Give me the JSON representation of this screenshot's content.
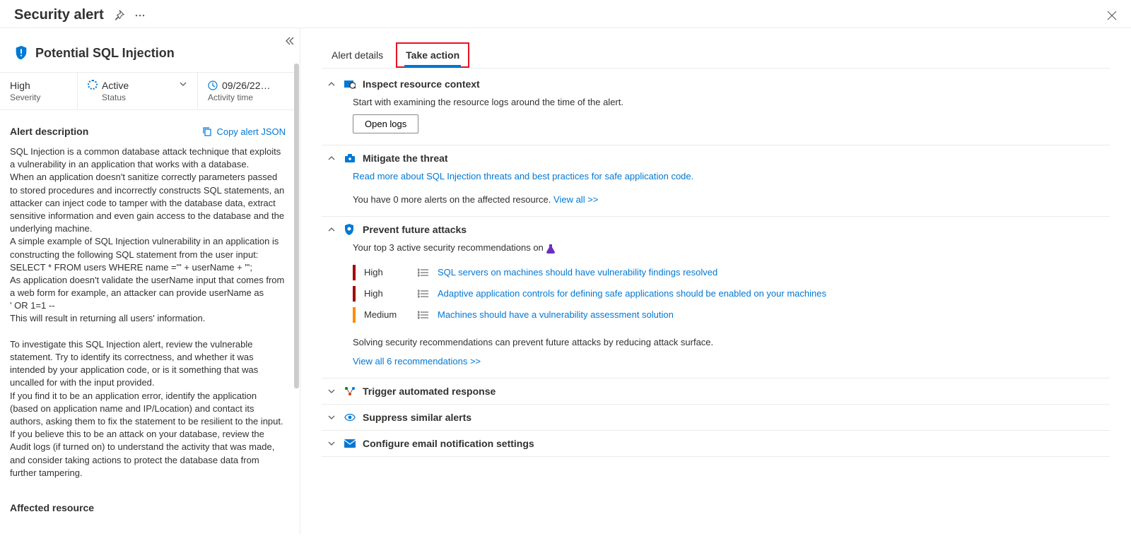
{
  "header": {
    "title": "Security alert"
  },
  "alert": {
    "title": "Potential SQL Injection",
    "severity": {
      "value": "High",
      "label": "Severity"
    },
    "status": {
      "value": "Active",
      "label": "Status"
    },
    "time": {
      "value": "09/26/22…",
      "label": "Activity time"
    }
  },
  "description": {
    "heading": "Alert description",
    "copy_label": "Copy alert JSON",
    "text": "SQL Injection is a common database attack technique that exploits a vulnerability in an application that works with a database.\nWhen an application doesn't sanitize correctly parameters passed to stored procedures and incorrectly constructs SQL statements, an attacker can inject code to tamper with the database data, extract sensitive information and even gain access to the database and the underlying machine.\nA simple example of SQL Injection vulnerability in an application is constructing the following SQL statement from the user input:\nSELECT * FROM users WHERE name ='\" + userName + \"';\nAs application doesn't validate the userName input that comes from a web form for example, an attacker can provide userName as\n' OR 1=1 --\nThis will result in returning all users' information.\n\nTo investigate this SQL Injection alert, review the vulnerable statement. Try to identify its correctness, and whether it was intended by your application code, or is it something that was uncalled for with the input provided.\nIf you find it to be an application error, identify the application (based on application name and IP/Location) and contact its authors, asking them to fix the statement to be resilient to the input.\nIf you believe this to be an attack on your database, review the Audit logs (if turned on) to understand the activity that was made, and consider taking actions to protect the database data from further tampering."
  },
  "affected": {
    "heading": "Affected resource"
  },
  "tabs": {
    "details": "Alert details",
    "action": "Take action"
  },
  "actions": {
    "inspect": {
      "title": "Inspect resource context",
      "text": "Start with examining the resource logs around the time of the alert.",
      "button": "Open logs"
    },
    "mitigate": {
      "title": "Mitigate the threat",
      "link": "Read more about SQL Injection threats and best practices for safe application code.",
      "text_prefix": "You have 0 more alerts on the affected resource. ",
      "view_all": "View all >>"
    },
    "prevent": {
      "title": "Prevent future attacks",
      "intro": "Your top 3 active security recommendations on ",
      "recs": [
        {
          "severity": "High",
          "sev_class": "sev-high",
          "text": "SQL servers on machines should have vulnerability findings resolved"
        },
        {
          "severity": "High",
          "sev_class": "sev-high",
          "text": "Adaptive application controls for defining safe applications should be enabled on your machines"
        },
        {
          "severity": "Medium",
          "sev_class": "sev-medium",
          "text": "Machines should have a vulnerability assessment solution"
        }
      ],
      "footer": "Solving security recommendations can prevent future attacks by reducing attack surface.",
      "view_all": "View all 6 recommendations >>"
    },
    "trigger": {
      "title": "Trigger automated response"
    },
    "suppress": {
      "title": "Suppress similar alerts"
    },
    "email": {
      "title": "Configure email notification settings"
    }
  }
}
